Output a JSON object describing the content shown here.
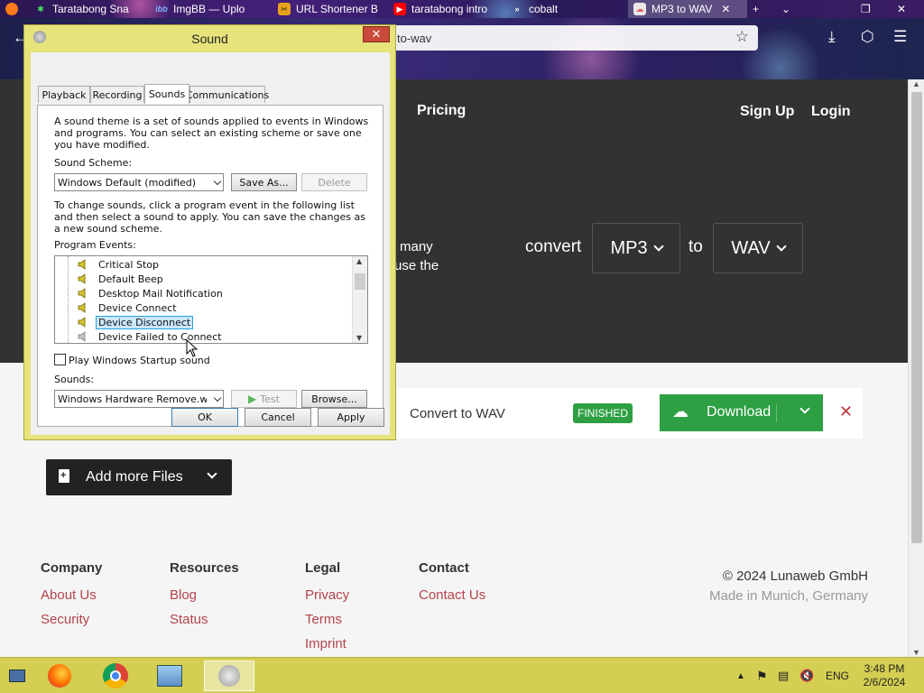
{
  "browser": {
    "tabs": [
      {
        "label": "Taratabong Sna",
        "icon": "linktree-icon",
        "color": "#43e55e"
      },
      {
        "label": "ImgBB — Uplo",
        "icon": "imgbb-icon",
        "color": "#2a5fbf"
      },
      {
        "label": "URL Shortener B",
        "icon": "url-shortener-icon",
        "color": "#e7a21b"
      },
      {
        "label": "taratabong intro",
        "icon": "youtube-icon",
        "color": "#ff0000"
      },
      {
        "label": "cobalt",
        "icon": "cobalt-icon",
        "color": "#222222"
      },
      {
        "label": "MP3 to WAV",
        "icon": "cloudconvert-icon",
        "color": "#e25f5f",
        "active": true
      }
    ],
    "url": "to-wav"
  },
  "site": {
    "nav": {
      "pricing": "Pricing",
      "signup": "Sign Up",
      "login": "Login"
    },
    "hero_text_line1": "many",
    "hero_text_line2": "use the",
    "convert_label": "convert",
    "from_format": "MP3",
    "to_label": "to",
    "to_format": "WAV",
    "file_action": "Convert to WAV",
    "status_badge": "FINISHED",
    "download_label": "Download",
    "add_files_label": "Add more Files",
    "footer": {
      "company": {
        "title": "Company",
        "links": [
          "About Us",
          "Security"
        ]
      },
      "resources": {
        "title": "Resources",
        "links": [
          "Blog",
          "Status"
        ]
      },
      "legal": {
        "title": "Legal",
        "links": [
          "Privacy",
          "Terms",
          "Imprint"
        ]
      },
      "contact": {
        "title": "Contact",
        "links": [
          "Contact Us"
        ]
      },
      "copyright": "© 2024 Lunaweb GmbH",
      "made_in": "Made in Munich, Germany"
    }
  },
  "dialog": {
    "title": "Sound",
    "tabs": [
      "Playback",
      "Recording",
      "Sounds",
      "Communications"
    ],
    "selected_tab": "Sounds",
    "intro_text": "A sound theme is a set of sounds applied to events in Windows and programs.  You can select an existing scheme or save one you have modified.",
    "scheme_label": "Sound Scheme:",
    "scheme_value": "Windows Default (modified)",
    "save_as": "Save As...",
    "delete": "Delete",
    "change_text": "To change sounds, click a program event in the following list and then select a sound to apply.  You can save the changes as a new sound scheme.",
    "events_label": "Program Events:",
    "events": [
      "Critical Stop",
      "Default Beep",
      "Desktop Mail Notification",
      "Device Connect",
      "Device Disconnect",
      "Device Failed to Connect"
    ],
    "selected_event": "Device Disconnect",
    "startup_checkbox": "Play Windows Startup sound",
    "startup_checked": false,
    "sounds_label": "Sounds:",
    "sound_value": "Windows Hardware Remove.wav",
    "test": "Test",
    "browse": "Browse...",
    "ok": "OK",
    "cancel": "Cancel",
    "apply": "Apply"
  },
  "taskbar": {
    "language": "ENG",
    "time": "3:48 PM",
    "date": "2/6/2024"
  }
}
